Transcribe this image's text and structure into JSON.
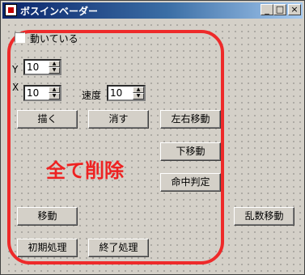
{
  "window": {
    "title": "ボスインベーダー"
  },
  "controls": {
    "moving_checkbox_label": "動いている",
    "y_label": "Y",
    "y_value": "10",
    "x_label": "X",
    "x_value": "10",
    "speed_label": "速度",
    "speed_value": "10"
  },
  "buttons": {
    "draw": "描く",
    "erase": "消す",
    "move_lr": "左右移動",
    "move_down": "下移動",
    "hit_test": "命中判定",
    "move": "移動",
    "random_move": "乱数移動",
    "init": "初期処理",
    "finish": "終了処理"
  },
  "annotation": {
    "text": "全て削除",
    "color": "#ee2222"
  }
}
